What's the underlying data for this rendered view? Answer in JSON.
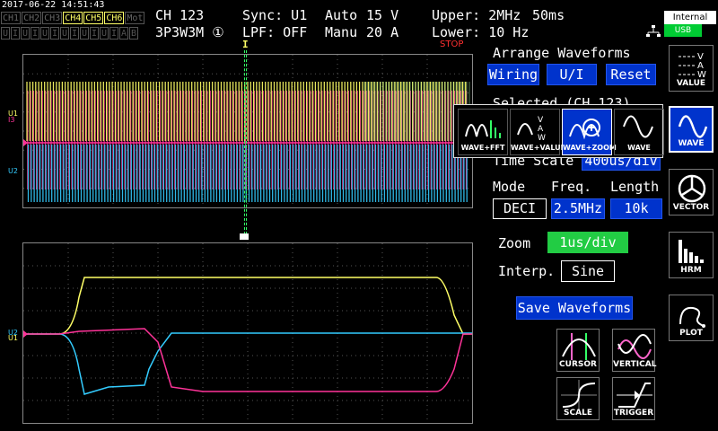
{
  "status": {
    "datetime": "2017-06-22 14:51:43",
    "channels_top": [
      "CH1",
      "CH2",
      "CH3",
      "CH4",
      "CH5",
      "CH6",
      "Mot"
    ],
    "channels_active": [
      "CH4",
      "CH5",
      "CH6"
    ],
    "channels_bottom": [
      "U",
      "I",
      "U",
      "I",
      "U",
      "I",
      "U",
      "I",
      "U",
      "I",
      "U",
      "I",
      "A",
      "B"
    ],
    "ch_label": "CH 123",
    "wiring": "3P3W3M",
    "wiring_badge": "①",
    "sync": "Sync: U1",
    "lpf": "LPF: OFF",
    "range_mode_1": "Auto",
    "range_val_1": "15 V",
    "range_mode_2": "Manu",
    "range_val_2": "20 A",
    "upper": "Upper: 2MHz",
    "time_window": "50ms",
    "lower": "Lower: 10 Hz",
    "stop": "STOP",
    "internal": "Internal",
    "usb": "USB"
  },
  "waveform": {
    "top_labels": [
      "U1",
      "I3",
      "U2"
    ],
    "bottom_labels": [
      "U2",
      "U1"
    ],
    "cursor_marker": "I",
    "colors": {
      "yellow": "#ffff66",
      "magenta": "#ff3399",
      "cyan": "#33ccff",
      "green": "#33ff66"
    }
  },
  "settings": {
    "arrange_title": "Arrange Waveforms",
    "wiring_btn": "Wiring",
    "ui_btn": "U/I",
    "reset_btn": "Reset",
    "selected_partial": "Selected (CH 123)",
    "time_scale_label": "Time Scale",
    "time_scale_value": "400us/div",
    "mode_label": "Mode",
    "freq_label": "Freq.",
    "length_label": "Length",
    "mode_value": "DECI",
    "freq_value": "2.5MHz",
    "length_value": "10k",
    "zoom_label": "Zoom",
    "zoom_value": "1us/div",
    "interp_label": "Interp.",
    "interp_value": "Sine",
    "save_btn": "Save Waveforms"
  },
  "wave_popup": {
    "items": [
      "WAVE+FFT",
      "WAVE+VALUE",
      "WAVE+ZOOM",
      "WAVE"
    ],
    "selected": "WAVE+ZOOM"
  },
  "side_menu": {
    "items": [
      "VALUE",
      "WAVE",
      "VECTOR",
      "HRM",
      "PLOT"
    ],
    "selected": "WAVE"
  },
  "tools": [
    "CURSOR",
    "VERTICAL",
    "SCALE",
    "TRIGGER"
  ]
}
